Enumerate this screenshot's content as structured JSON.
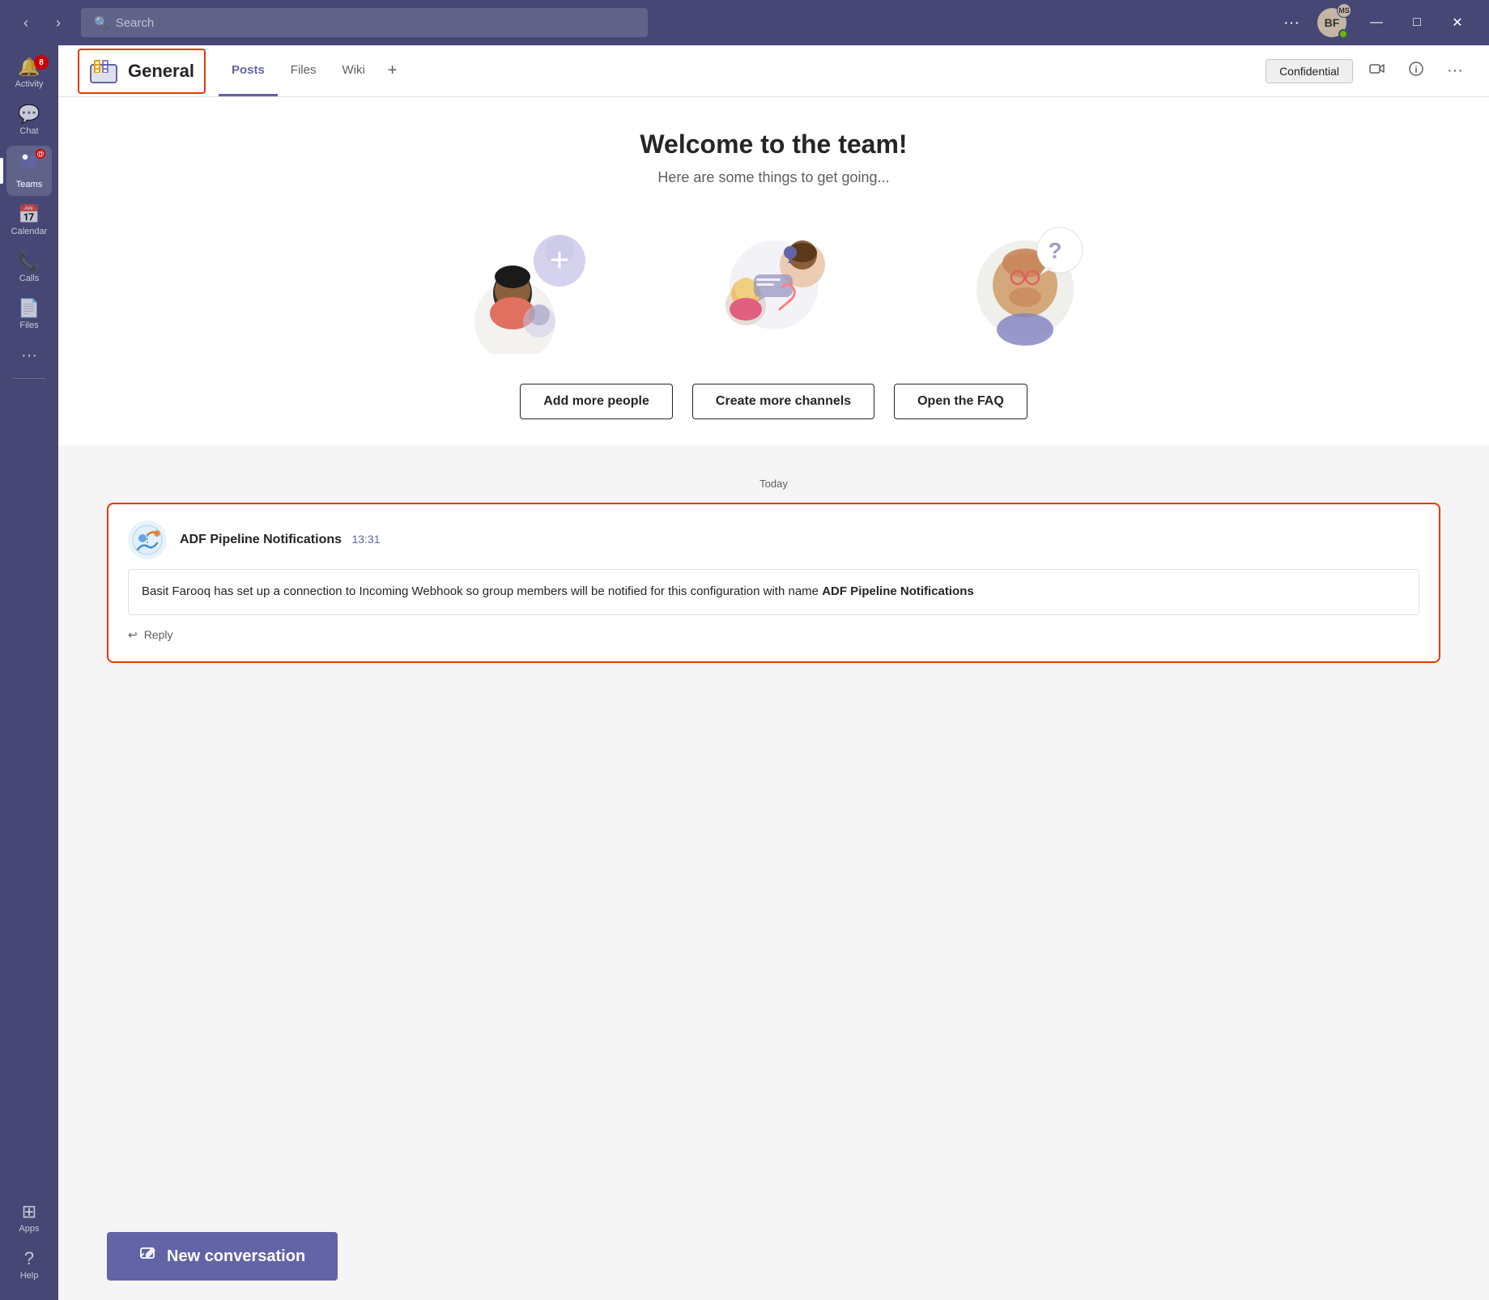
{
  "titleBar": {
    "searchPlaceholder": "Search",
    "avatar": {
      "initials": "BF",
      "msBadge": "MS"
    },
    "backLabel": "‹",
    "forwardLabel": "›",
    "moreLabel": "···",
    "minimize": "—",
    "maximize": "□",
    "close": "✕"
  },
  "sidebar": {
    "items": [
      {
        "id": "activity",
        "label": "Activity",
        "icon": "🔔",
        "badge": "8",
        "active": false
      },
      {
        "id": "chat",
        "label": "Chat",
        "icon": "💬",
        "badge": null,
        "active": false
      },
      {
        "id": "teams",
        "label": "Teams",
        "icon": "👥",
        "badge": "@",
        "active": true
      },
      {
        "id": "calendar",
        "label": "Calendar",
        "icon": "📅",
        "badge": null,
        "active": false
      },
      {
        "id": "calls",
        "label": "Calls",
        "icon": "📞",
        "badge": null,
        "active": false
      },
      {
        "id": "files",
        "label": "Files",
        "icon": "📄",
        "badge": null,
        "active": false
      }
    ],
    "more": "···",
    "apps": {
      "label": "Apps",
      "icon": "⊞"
    },
    "help": {
      "label": "Help",
      "icon": "?"
    }
  },
  "channel": {
    "name": "General",
    "tabs": [
      "Posts",
      "Files",
      "Wiki"
    ],
    "activeTab": "Posts",
    "addTabLabel": "+",
    "confidentialLabel": "Confidential",
    "videoIcon": "📹",
    "infoIcon": "ℹ",
    "moreIcon": "···"
  },
  "welcome": {
    "title": "Welcome to the team!",
    "subtitle": "Here are some things to get going...",
    "addPeopleBtn": "Add more people",
    "createChannelsBtn": "Create more channels",
    "openFaqBtn": "Open the FAQ"
  },
  "posts": {
    "dateDivider": "Today",
    "message": {
      "sender": "ADF Pipeline Notifications",
      "time": "13:31",
      "body": "Basit Farooq has set up a connection to Incoming Webhook so group members will be notified for this configuration with name ",
      "bodyBold": "ADF Pipeline Notifications",
      "replyLabel": "↩  Reply"
    }
  },
  "newConversation": {
    "label": "New conversation",
    "icon": "✎"
  }
}
